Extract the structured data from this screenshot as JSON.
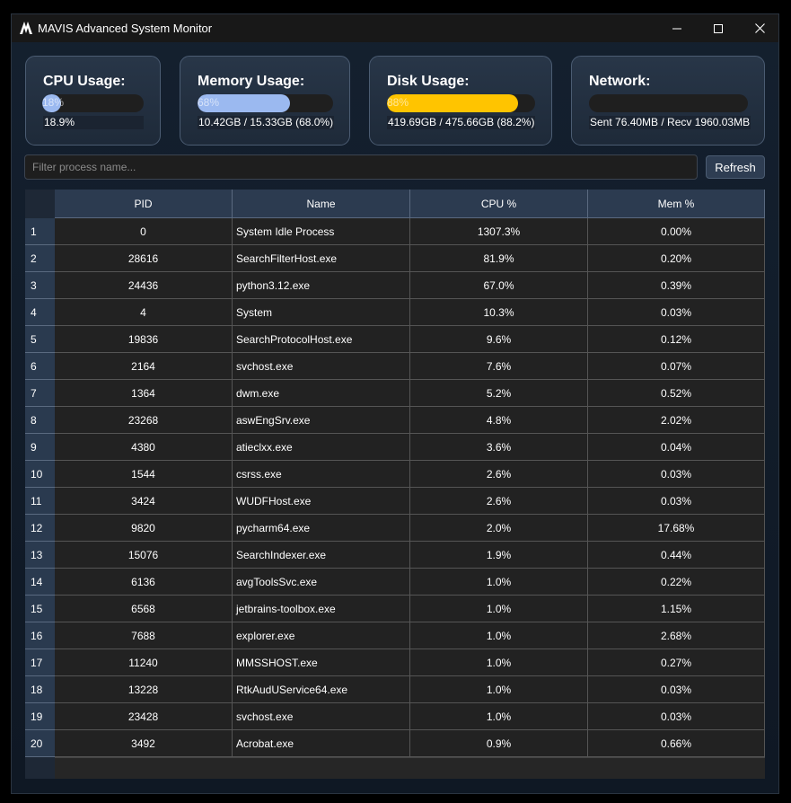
{
  "window": {
    "title": "MAVIS Advanced System Monitor"
  },
  "cards": {
    "cpu": {
      "title": "CPU Usage:",
      "bar_text": "18%",
      "value": 0.189,
      "sub": "18.9%",
      "color": "#9bb9f0"
    },
    "memory": {
      "title": "Memory Usage:",
      "bar_text": "68%",
      "value": 0.68,
      "sub": "10.42GB / 15.33GB (68.0%)",
      "color": "#9bb9f0"
    },
    "disk": {
      "title": "Disk Usage:",
      "bar_text": "88%",
      "value": 0.882,
      "sub": "419.69GB / 475.66GB (88.2%)",
      "color": "#ffc400"
    },
    "network": {
      "title": "Network:",
      "bar_text": "",
      "value": 0,
      "sub": "Sent 76.40MB / Recv 1960.03MB",
      "color": "#9bb9f0"
    }
  },
  "filter": {
    "placeholder": "Filter process name...",
    "value": ""
  },
  "refresh_label": "Refresh",
  "table": {
    "columns": [
      "PID",
      "Name",
      "CPU %",
      "Mem %"
    ],
    "rows": [
      {
        "index": "1",
        "pid": "0",
        "name": "System Idle Process",
        "cpu": "1307.3%",
        "mem": "0.00%"
      },
      {
        "index": "2",
        "pid": "28616",
        "name": "SearchFilterHost.exe",
        "cpu": "81.9%",
        "mem": "0.20%"
      },
      {
        "index": "3",
        "pid": "24436",
        "name": "python3.12.exe",
        "cpu": "67.0%",
        "mem": "0.39%"
      },
      {
        "index": "4",
        "pid": "4",
        "name": "System",
        "cpu": "10.3%",
        "mem": "0.03%"
      },
      {
        "index": "5",
        "pid": "19836",
        "name": "SearchProtocolHost.exe",
        "cpu": "9.6%",
        "mem": "0.12%"
      },
      {
        "index": "6",
        "pid": "2164",
        "name": "svchost.exe",
        "cpu": "7.6%",
        "mem": "0.07%"
      },
      {
        "index": "7",
        "pid": "1364",
        "name": "dwm.exe",
        "cpu": "5.2%",
        "mem": "0.52%"
      },
      {
        "index": "8",
        "pid": "23268",
        "name": "aswEngSrv.exe",
        "cpu": "4.8%",
        "mem": "2.02%"
      },
      {
        "index": "9",
        "pid": "4380",
        "name": "atieclxx.exe",
        "cpu": "3.6%",
        "mem": "0.04%"
      },
      {
        "index": "10",
        "pid": "1544",
        "name": "csrss.exe",
        "cpu": "2.6%",
        "mem": "0.03%"
      },
      {
        "index": "11",
        "pid": "3424",
        "name": "WUDFHost.exe",
        "cpu": "2.6%",
        "mem": "0.03%"
      },
      {
        "index": "12",
        "pid": "9820",
        "name": "pycharm64.exe",
        "cpu": "2.0%",
        "mem": "17.68%"
      },
      {
        "index": "13",
        "pid": "15076",
        "name": "SearchIndexer.exe",
        "cpu": "1.9%",
        "mem": "0.44%"
      },
      {
        "index": "14",
        "pid": "6136",
        "name": "avgToolsSvc.exe",
        "cpu": "1.0%",
        "mem": "0.22%"
      },
      {
        "index": "15",
        "pid": "6568",
        "name": "jetbrains-toolbox.exe",
        "cpu": "1.0%",
        "mem": "1.15%"
      },
      {
        "index": "16",
        "pid": "7688",
        "name": "explorer.exe",
        "cpu": "1.0%",
        "mem": "2.68%"
      },
      {
        "index": "17",
        "pid": "11240",
        "name": "MMSSHOST.exe",
        "cpu": "1.0%",
        "mem": "0.27%"
      },
      {
        "index": "18",
        "pid": "13228",
        "name": "RtkAudUService64.exe",
        "cpu": "1.0%",
        "mem": "0.03%"
      },
      {
        "index": "19",
        "pid": "23428",
        "name": "svchost.exe",
        "cpu": "1.0%",
        "mem": "0.03%"
      },
      {
        "index": "20",
        "pid": "3492",
        "name": "Acrobat.exe",
        "cpu": "0.9%",
        "mem": "0.66%"
      }
    ]
  }
}
